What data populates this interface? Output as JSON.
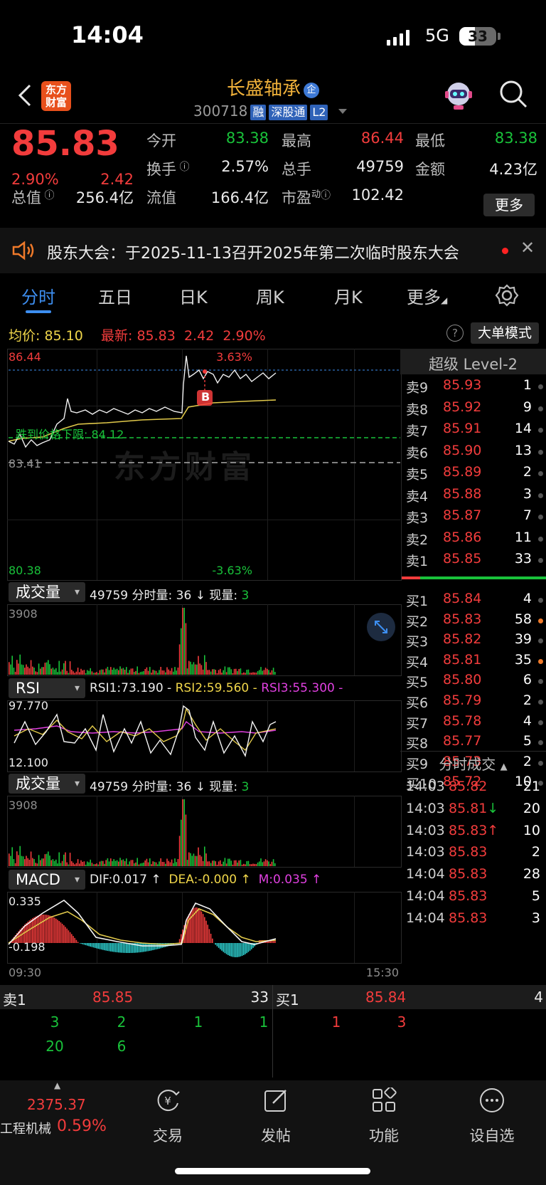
{
  "status_bar": {
    "time": "14:04",
    "network": "5G",
    "battery": "33"
  },
  "header": {
    "logo_text": "东方财富",
    "stock_name": "长盛轴承",
    "name_badge": "企",
    "stock_code": "300718",
    "tags": [
      "融",
      "深股通",
      "L2"
    ]
  },
  "quote": {
    "price": "85.83",
    "change_pct": "2.90%",
    "change": "2.42",
    "rows": [
      [
        {
          "label": "今开",
          "value": "83.38",
          "color": "green"
        },
        {
          "label": "最高",
          "value": "86.44",
          "color": "red"
        },
        {
          "label": "最低",
          "value": "83.38",
          "color": "green"
        }
      ],
      [
        {
          "label": "换手",
          "value": "2.57%",
          "color": "white"
        },
        {
          "label": "总手",
          "value": "49759",
          "color": "white"
        },
        {
          "label": "金额",
          "value": "4.23亿",
          "color": "white"
        }
      ]
    ],
    "row3": [
      {
        "label": "总值",
        "value": "256.4亿"
      },
      {
        "label": "流值",
        "value": "166.4亿"
      },
      {
        "label": "市盈",
        "sup": "动",
        "value": "102.42"
      }
    ],
    "more_label": "更多"
  },
  "notice": {
    "text": "股东大会：于2025-11-13召开2025年第二次临时股东大会"
  },
  "tabs": {
    "items": [
      "分时",
      "五日",
      "日K",
      "周K",
      "月K",
      "更多"
    ],
    "active": 0
  },
  "avg_line": {
    "avg_label": "均价:",
    "avg_value": "85.10",
    "latest_label": "最新:",
    "latest_value": "85.83",
    "change": "2.42",
    "change_pct": "2.90%",
    "big_order_label": "大单模式"
  },
  "intraday_chart": {
    "price_high": "86.44",
    "price_low": "80.38",
    "pct_high": "3.63%",
    "pct_low": "-3.63%",
    "prev_close": "83.41",
    "limit_down_label": "跌到价格下限: 84.12",
    "buy_marker": "B",
    "watermark": "东方财富"
  },
  "volume_panel_1": {
    "selector": "成交量",
    "info_total": "49759",
    "info_label": "分时量:",
    "info_value": "36",
    "info_arrow": "↓",
    "now_label": "现量:",
    "now_value": "3",
    "ymax": "3908"
  },
  "rsi_panel": {
    "selector": "RSI",
    "rsi1": "RSI1:73.190 -",
    "rsi2": "RSI2:59.560 -",
    "rsi3": "RSI3:55.300 -",
    "ymax": "97.770",
    "ymin": "12.100"
  },
  "volume_panel_2": {
    "selector": "成交量",
    "info_total": "49759",
    "info_label": "分时量:",
    "info_value": "36",
    "info_arrow": "↓",
    "now_label": "现量:",
    "now_value": "3",
    "ymax": "3908"
  },
  "macd_panel": {
    "selector": "MACD",
    "dif": "DIF:0.017 ↑",
    "dea": "DEA:-0.000 ↑",
    "m": "M:0.035 ↑",
    "ymax": "0.335",
    "ymin": "-0.198",
    "time_start": "09:30",
    "time_end": "15:30"
  },
  "level2": {
    "title": "超级 Level-2",
    "asks": [
      {
        "k": "卖9",
        "p": "85.93",
        "v": "1"
      },
      {
        "k": "卖8",
        "p": "85.92",
        "v": "9"
      },
      {
        "k": "卖7",
        "p": "85.91",
        "v": "14"
      },
      {
        "k": "卖6",
        "p": "85.90",
        "v": "13"
      },
      {
        "k": "卖5",
        "p": "85.89",
        "v": "2"
      },
      {
        "k": "卖4",
        "p": "85.88",
        "v": "3"
      },
      {
        "k": "卖3",
        "p": "85.87",
        "v": "7"
      },
      {
        "k": "卖2",
        "p": "85.86",
        "v": "11"
      },
      {
        "k": "卖1",
        "p": "85.85",
        "v": "33"
      }
    ],
    "bids": [
      {
        "k": "买1",
        "p": "85.84",
        "v": "4",
        "dot": "grey"
      },
      {
        "k": "买2",
        "p": "85.83",
        "v": "58",
        "dot": "orange"
      },
      {
        "k": "买3",
        "p": "85.82",
        "v": "39",
        "dot": "grey"
      },
      {
        "k": "买4",
        "p": "85.81",
        "v": "35",
        "dot": "orange"
      },
      {
        "k": "买5",
        "p": "85.80",
        "v": "6",
        "dot": "grey"
      },
      {
        "k": "买6",
        "p": "85.79",
        "v": "2",
        "dot": "grey"
      },
      {
        "k": "买7",
        "p": "85.78",
        "v": "4",
        "dot": "grey"
      },
      {
        "k": "买8",
        "p": "85.77",
        "v": "5",
        "dot": "grey"
      },
      {
        "k": "买9",
        "p": "85.73",
        "v": "2",
        "dot": "grey"
      },
      {
        "k": "买10",
        "p": "85.72",
        "v": "10",
        "dot": "grey"
      }
    ],
    "ticks_title": "分时成交",
    "ticks": [
      {
        "t": "14:03",
        "p": "85.82",
        "a": "",
        "v": "21",
        "vc": "red"
      },
      {
        "t": "14:03",
        "p": "85.81",
        "a": "↓",
        "v": "20",
        "vc": "green"
      },
      {
        "t": "14:03",
        "p": "85.83",
        "a": "↑",
        "v": "10",
        "vc": "red"
      },
      {
        "t": "14:03",
        "p": "85.83",
        "a": "",
        "v": "2",
        "vc": "red"
      },
      {
        "t": "14:04",
        "p": "85.83",
        "a": "",
        "v": "28",
        "vc": "red"
      },
      {
        "t": "14:04",
        "p": "85.83",
        "a": "",
        "v": "5",
        "vc": "green"
      },
      {
        "t": "14:04",
        "p": "85.83",
        "a": "",
        "v": "3",
        "vc": "green"
      }
    ]
  },
  "book": {
    "ask_label": "卖1",
    "ask_price": "85.85",
    "ask_qty": "33",
    "bid_label": "买1",
    "bid_price": "85.84",
    "bid_qty": "4",
    "ask_row1": [
      "3",
      "2",
      "1",
      "1"
    ],
    "ask_row2": [
      "20",
      "6"
    ],
    "bid_row1": [
      "1",
      "3"
    ]
  },
  "footer": {
    "index_value": "2375.37",
    "index_name": "工程机械",
    "index_pct": "0.59%",
    "nav": [
      "交易",
      "发帖",
      "功能",
      "设自选"
    ]
  }
}
